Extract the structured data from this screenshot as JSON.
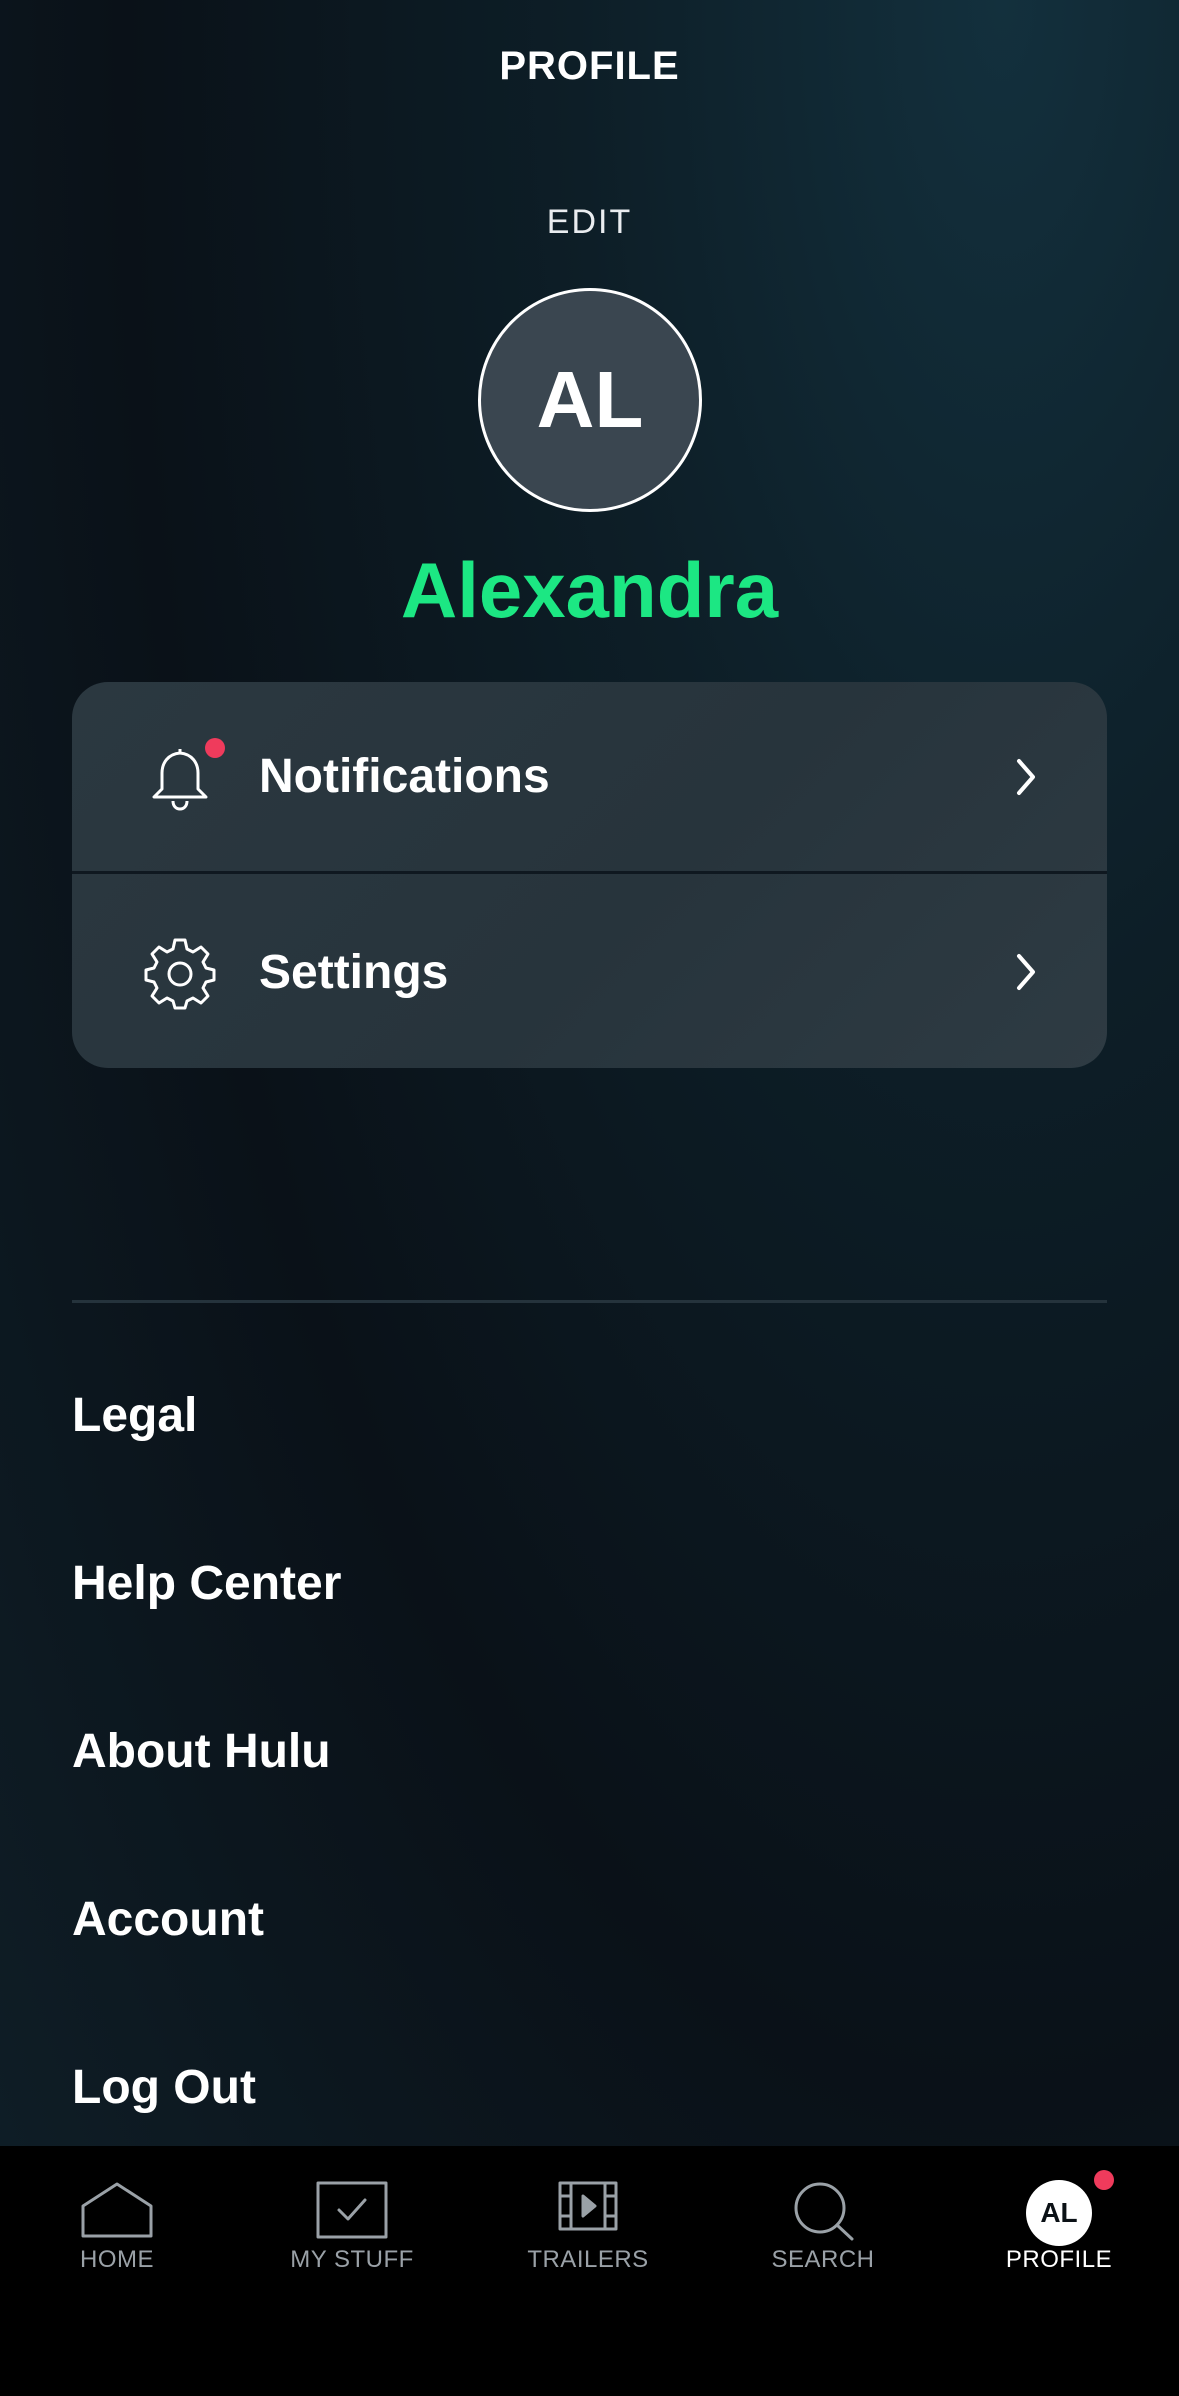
{
  "header": {
    "title": "PROFILE",
    "edit_label": "EDIT"
  },
  "profile": {
    "initials": "AL",
    "name": "Alexandra",
    "name_color": "#1ce783"
  },
  "card": {
    "items": [
      {
        "label": "Notifications",
        "icon": "bell-icon",
        "has_badge": true
      },
      {
        "label": "Settings",
        "icon": "gear-icon",
        "has_badge": false
      }
    ]
  },
  "links": [
    {
      "label": "Legal"
    },
    {
      "label": "Help Center"
    },
    {
      "label": "About Hulu"
    },
    {
      "label": "Account"
    },
    {
      "label": "Log Out"
    }
  ],
  "tabbar": {
    "tabs": [
      {
        "label": "HOME",
        "icon": "home-icon",
        "active": false
      },
      {
        "label": "MY STUFF",
        "icon": "my-stuff-icon",
        "active": false
      },
      {
        "label": "TRAILERS",
        "icon": "film-icon",
        "active": false
      },
      {
        "label": "SEARCH",
        "icon": "search-icon",
        "active": false
      },
      {
        "label": "PROFILE",
        "icon": "avatar-icon",
        "active": true,
        "initials": "AL"
      }
    ]
  },
  "colors": {
    "badge": "#ef3b5c",
    "accent": "#1ce783"
  }
}
